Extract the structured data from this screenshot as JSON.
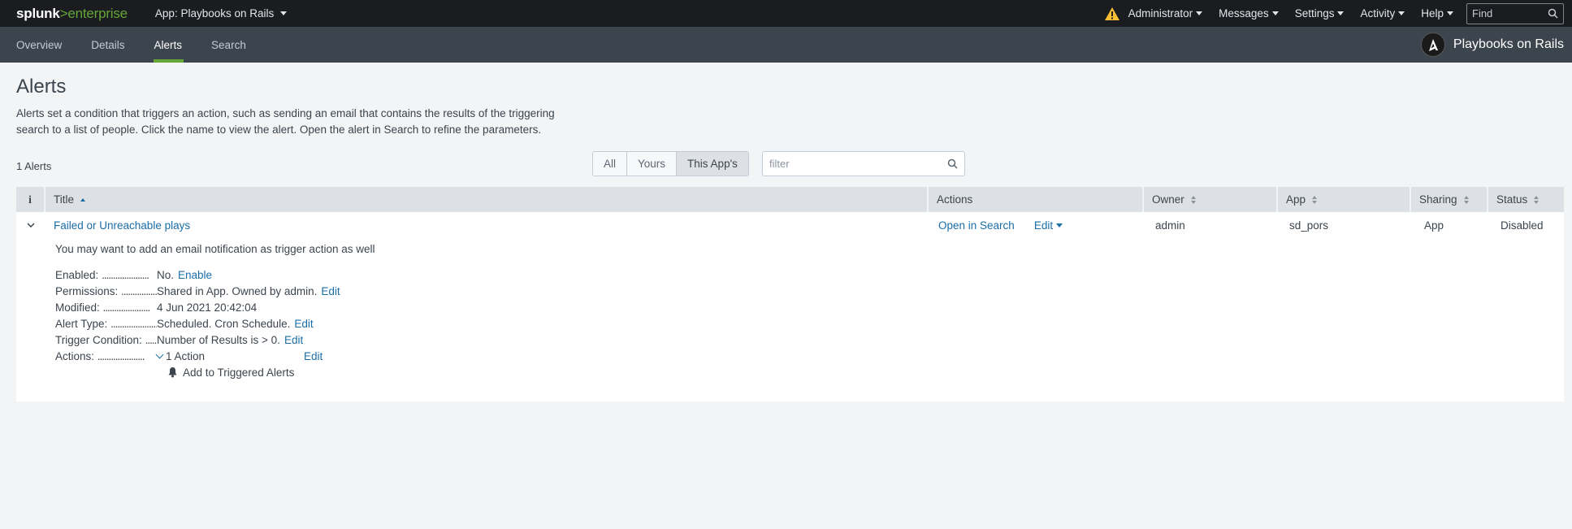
{
  "topbar": {
    "logo_main": "splunk",
    "logo_accent": ">enterprise",
    "app_menu": "App: Playbooks on Rails",
    "warning_icon": "warning-triangle-icon",
    "warning_color": "#f8be34",
    "menus": [
      "Administrator",
      "Messages",
      "Settings",
      "Activity",
      "Help"
    ],
    "find_placeholder": "Find"
  },
  "appbar": {
    "tabs": [
      "Overview",
      "Details",
      "Alerts",
      "Search"
    ],
    "active_tab": "Alerts",
    "app_name": "Playbooks on Rails",
    "app_icon": "ansible-logo-icon"
  },
  "page": {
    "title": "Alerts",
    "description": "Alerts set a condition that triggers an action, such as sending an email that contains the results of the triggering search to a list of people. Click the name to view the alert. Open the alert in Search to refine the parameters.",
    "count": "1 Alerts",
    "filters": [
      "All",
      "Yours",
      "This App's"
    ],
    "active_filter": "This App's",
    "filter_placeholder": "filter"
  },
  "table": {
    "headers": {
      "info": "i",
      "title": "Title",
      "actions": "Actions",
      "owner": "Owner",
      "app": "App",
      "sharing": "Sharing",
      "status": "Status"
    },
    "row": {
      "title": "Failed or Unreachable plays",
      "open_in_search": "Open in Search",
      "edit": "Edit",
      "owner": "admin",
      "app": "sd_pors",
      "sharing": "App",
      "status": "Disabled"
    },
    "detail": {
      "note": "You may want to add an email notification as trigger action as well",
      "enabled_label": "Enabled:",
      "enabled_value": "No.",
      "enable_link": "Enable",
      "permissions_label": "Permissions:",
      "permissions_value": "Shared in App. Owned by admin.",
      "permissions_edit": "Edit",
      "modified_label": "Modified:",
      "modified_value": "4 Jun 2021 20:42:04",
      "alert_type_label": "Alert Type:",
      "alert_type_value": "Scheduled. Cron Schedule.",
      "alert_type_edit": "Edit",
      "trigger_label": "Trigger Condition:",
      "trigger_value": "Number of Results is > 0.",
      "trigger_edit": "Edit",
      "actions_label": "Actions:",
      "actions_value": "1 Action",
      "actions_edit": "Edit",
      "action_item": "Add to Triggered Alerts"
    }
  }
}
